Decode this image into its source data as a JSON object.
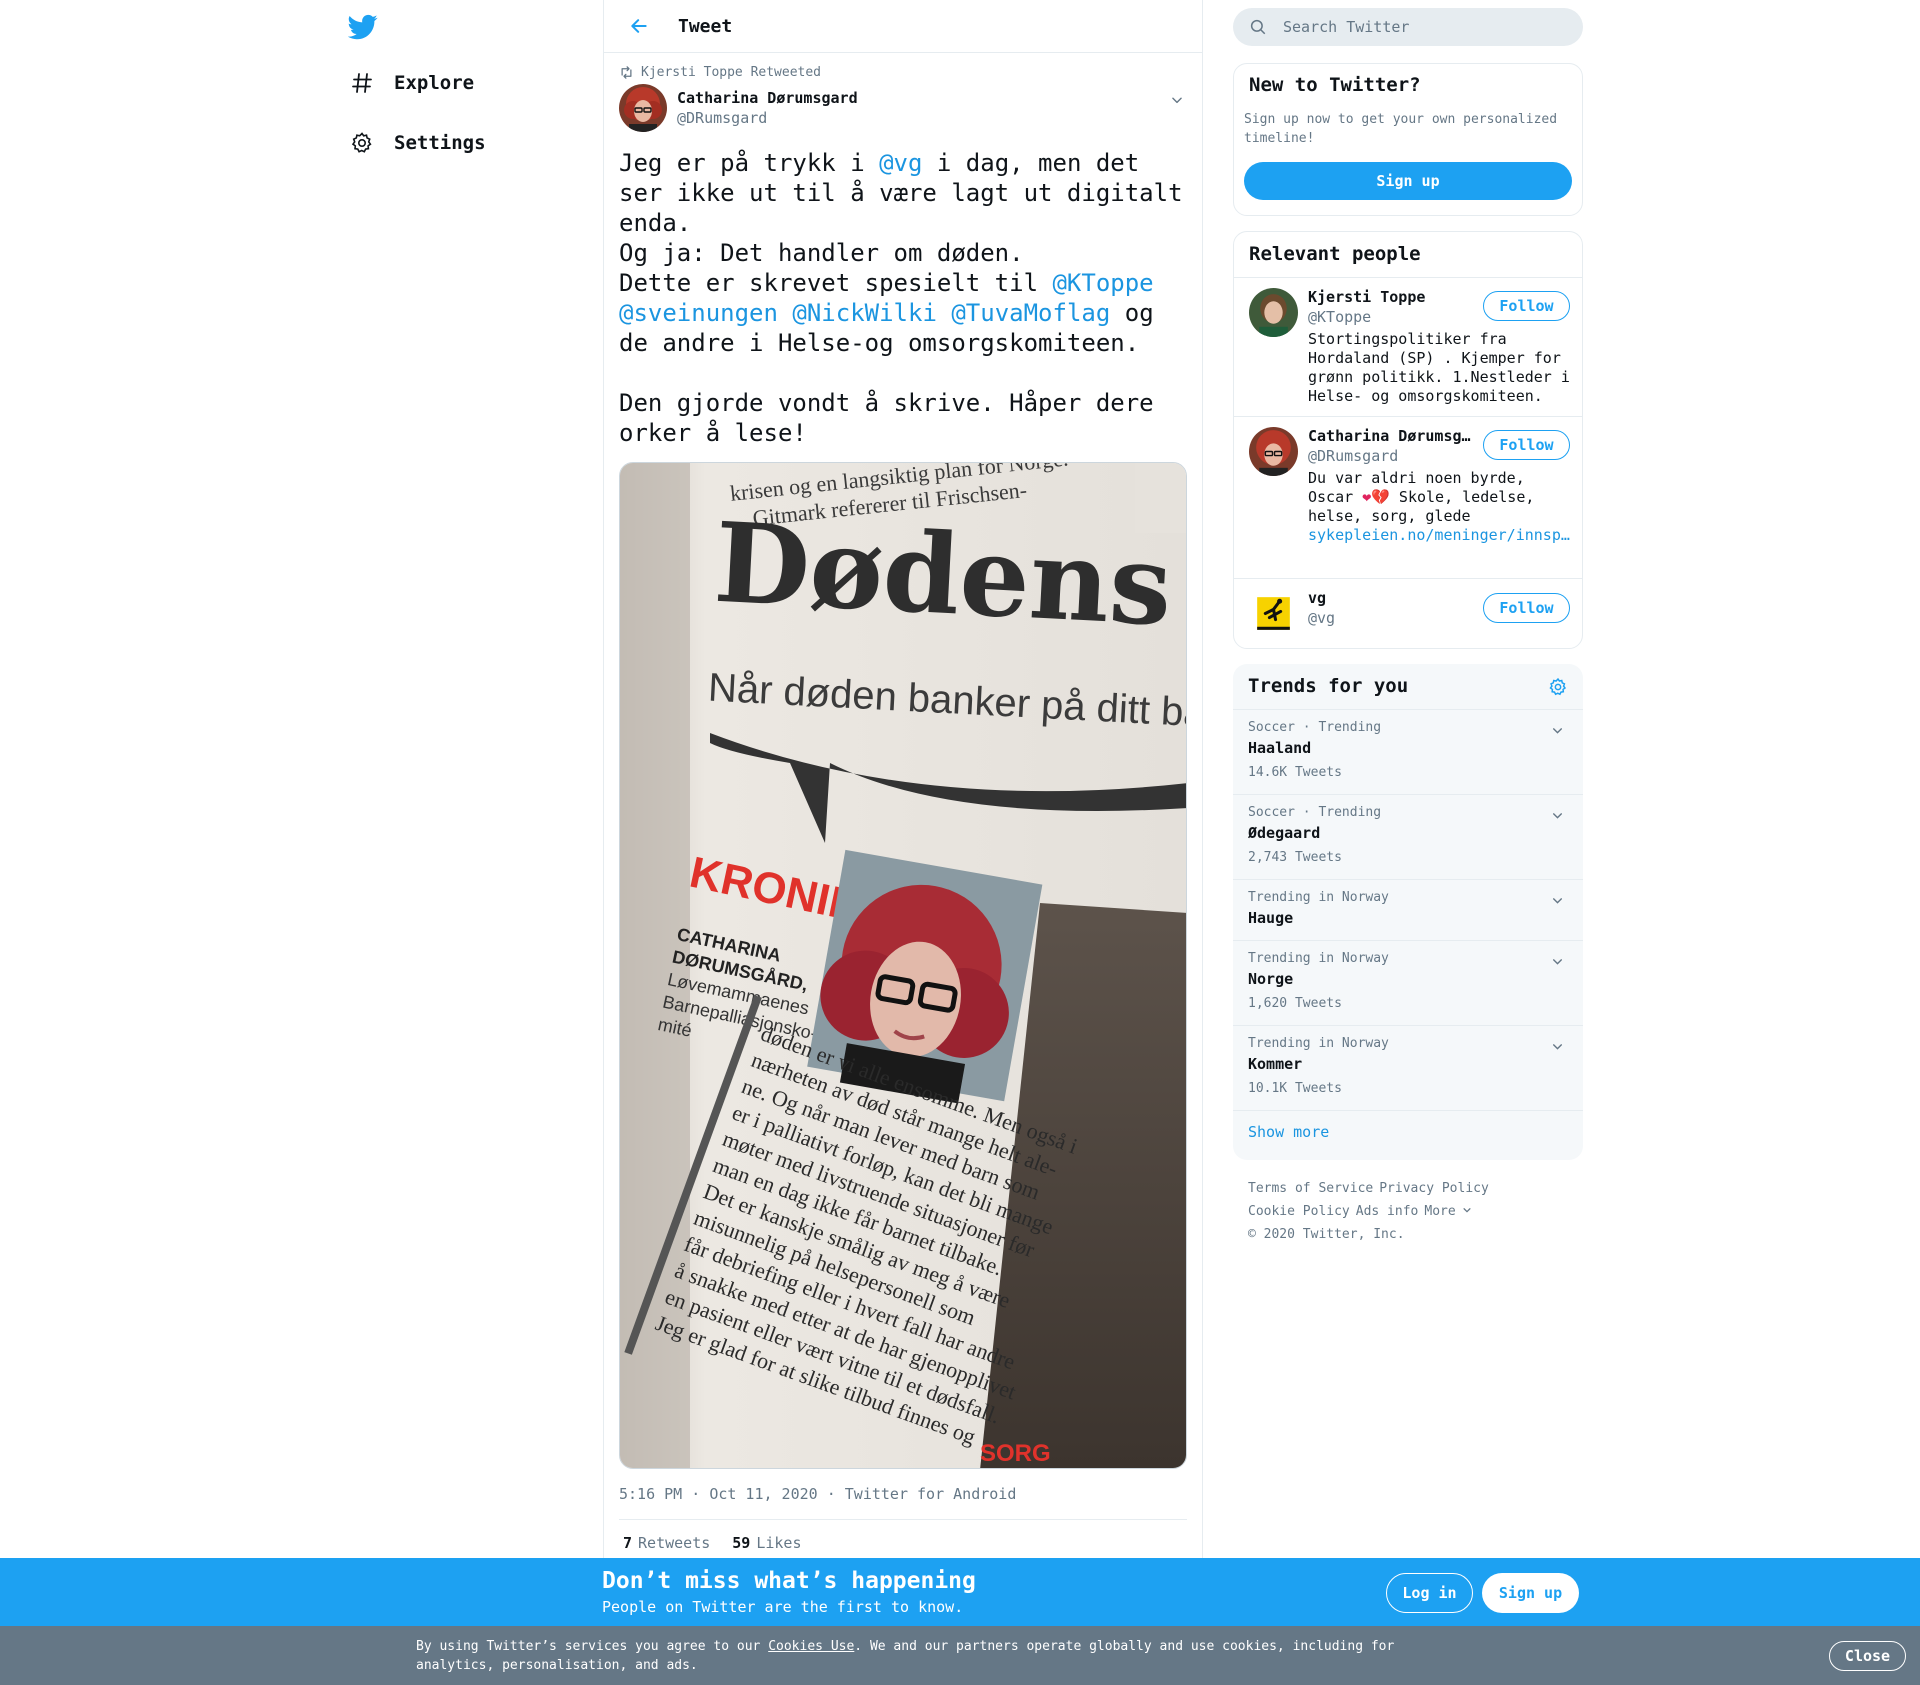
{
  "colors": {
    "accent": "#1da1f2",
    "link": "#1b95e0",
    "muted": "#657786",
    "banner": "#1da1f2",
    "cookie_bar": "#657786"
  },
  "nav": {
    "logo_icon": "twitter-bird-icon",
    "items": [
      {
        "label": "Explore",
        "icon": "hashtag-icon"
      },
      {
        "label": "Settings",
        "icon": "gear-icon"
      }
    ]
  },
  "header": {
    "title": "Tweet"
  },
  "tweet": {
    "retweeted_by": "Kjersti Toppe Retweeted",
    "author_name": "Catharina Dørumsgard",
    "author_handle": "@DRumsgard",
    "text_parts": [
      "Jeg er på trykk i ",
      "@vg",
      " i dag, men det ser ikke ut til å være lagt ut digitalt enda.\nOg ja: Det handler om døden.\nDette er skrevet spesielt til ",
      "@KToppe",
      " ",
      "@sveinungen",
      " ",
      "@NickWilki",
      " ",
      "@TuvaMoflag",
      " og de andre i Helse-og omsorgskomiteen.\n\nDen gjorde vondt å skrive. Håper dere orker å lese!"
    ],
    "photo_text": {
      "top_line1": "krisen og en langsiktig plan for Norge.",
      "top_line2": "Gitmark refererer til Frischsen-",
      "headline": "Dødens l",
      "subhead": "Når døden banker på ditt barns",
      "kronikk": "KRONIKK",
      "byline": [
        "CATHARINA",
        "DØRUMSGÅRD,",
        "Løvemammaenes",
        "Barnepalliasjonsko-",
        "mité"
      ],
      "body": [
        "døden er vi alle ensomme. Men også i",
        "nærheten av død står mange helt ale-",
        "ne. Og når man lever med barn som",
        "er i palliativt forløp, kan det bli mange",
        "møter med livstruende situasjoner før",
        "man en dag ikke får barnet tilbake.",
        "Det er kanskje smålig av meg å være",
        "misunnelig på helsepersonell som",
        "får debriefing eller i hvert fall har andre",
        "å snakke med etter at de har gjenopplivet",
        "en pasient eller vært vitne til et dødsfall.",
        "Jeg er glad for at slike tilbud finnes og"
      ],
      "sorg": "SORG"
    },
    "time": "5:16 PM",
    "date": "Oct 11, 2020",
    "source": "Twitter for Android",
    "retweets_count": "7",
    "retweets_label": "Retweets",
    "likes_count": "59",
    "likes_label": "Likes"
  },
  "search": {
    "placeholder": "Search Twitter"
  },
  "new_to_twitter": {
    "title": "New to Twitter?",
    "desc": "Sign up now to get your own personalized timeline!",
    "button": "Sign up"
  },
  "relevant_people": {
    "title": "Relevant people",
    "people": [
      {
        "name": "Kjersti Toppe",
        "handle": "@KToppe",
        "bio": "Stortingspolitiker fra Hordaland (SP) . Kjemper for grønn politikk. 1.Nestleder i Helse- og omsorgskomiteen.",
        "follow": "Follow"
      },
      {
        "name": "Catharina Dørumsgard",
        "handle": "@DRumsgard",
        "bio_prefix": "Du var aldri noen byrde, Oscar ",
        "bio_emoji": "❤💔",
        "bio_suffix": " Skole, ledelse, helse, sorg, glede",
        "bio_link": "sykepleien.no/meninger/innsp…",
        "follow": "Follow"
      },
      {
        "name": "vg",
        "handle": "@vg",
        "follow": "Follow"
      }
    ]
  },
  "trends": {
    "title": "Trends for you",
    "items": [
      {
        "context": "Soccer · Trending",
        "name": "Haaland",
        "count": "14.6K Tweets"
      },
      {
        "context": "Soccer · Trending",
        "name": "Ødegaard",
        "count": "2,743 Tweets"
      },
      {
        "context": "Trending in Norway",
        "name": "Hauge",
        "count": ""
      },
      {
        "context": "Trending in Norway",
        "name": "Norge",
        "count": "1,620 Tweets"
      },
      {
        "context": "Trending in Norway",
        "name": "Kommer",
        "count": "10.1K Tweets"
      }
    ],
    "show_more": "Show more"
  },
  "footer": {
    "links": [
      "Terms of Service",
      "Privacy Policy",
      "Cookie Policy",
      "Ads info",
      "More"
    ],
    "copyright": "© 2020 Twitter, Inc."
  },
  "banner": {
    "title": "Don’t miss what’s happening",
    "subtitle": "People on Twitter are the first to know.",
    "login": "Log in",
    "signup": "Sign up"
  },
  "cookie": {
    "before": "By using Twitter’s services you agree to our ",
    "link": "Cookies Use",
    "after": ". We and our partners operate globally and use cookies, including for analytics, personalisation, and ads.",
    "close": "Close"
  }
}
